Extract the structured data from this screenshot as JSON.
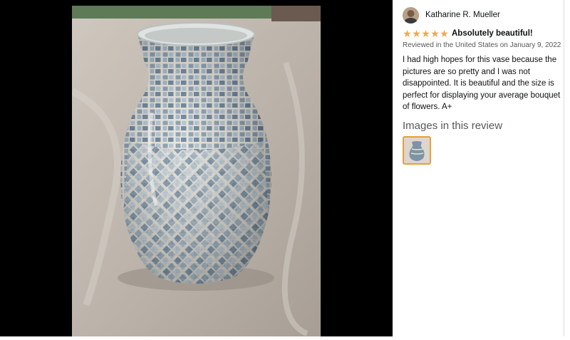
{
  "review": {
    "reviewer_name": "Katharine R. Mueller",
    "rating": 5,
    "rating_max": 5,
    "title": "Absolutely beautiful!",
    "meta": "Reviewed in the United States on January 9, 2022",
    "body": "I had high hopes for this vase because the pictures are so pretty and I was not disappointed. It is beautiful and the size is perfect for displaying your average bouquet of flowers. A+"
  },
  "images_section": {
    "heading": "Images in this review",
    "thumbnails": [
      "vase-photo-thumbnail"
    ]
  },
  "colors": {
    "star": "#f3a847",
    "thumb_border": "#e5a13a",
    "viewer_background": "#000000"
  },
  "icons": [
    "star-icon",
    "avatar"
  ]
}
